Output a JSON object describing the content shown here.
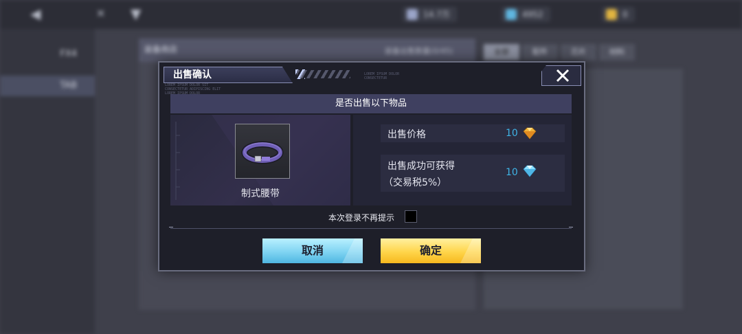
{
  "background": {
    "sidebar": [
      {
        "label": "FX4"
      },
      {
        "label": "TAB"
      }
    ],
    "left_panel_title": "装备商店",
    "left_panel_sub": "装备出售数量(0/45)",
    "right_tabs": [
      "全部",
      "配件",
      "芯片",
      "材料"
    ],
    "resources": [
      {
        "value": "14.7万"
      },
      {
        "value": "4952"
      },
      {
        "value": "0"
      }
    ]
  },
  "dialog": {
    "title": "出售确认",
    "lorem_top": "LOREM IPSUM DOLOR\nCONSECTETUR",
    "lorem_left": "LOREM IPSUM DOLOR SIT\nCONSECTETUR ADIPISCING ELIT\nLOREM IPSUM DOLOR",
    "question": "是否出售以下物品",
    "item": {
      "name": "制式腰带",
      "icon": "belt-icon"
    },
    "price_label": "出售价格",
    "price_value": "10",
    "price_currency_icon": "gold-gem-icon",
    "gain_label_line1": "出售成功可获得",
    "gain_label_line2": "（交易税5%）",
    "gain_value": "10",
    "gain_currency_icon": "diamond-icon",
    "dont_show_label": "本次登录不再提示",
    "cancel_label": "取消",
    "confirm_label": "确定"
  },
  "colors": {
    "value_text": "#3fb4e6",
    "cancel_button": "#7fd4f2",
    "confirm_button": "#ffd54a",
    "dialog_bg": "#1e1f29"
  }
}
